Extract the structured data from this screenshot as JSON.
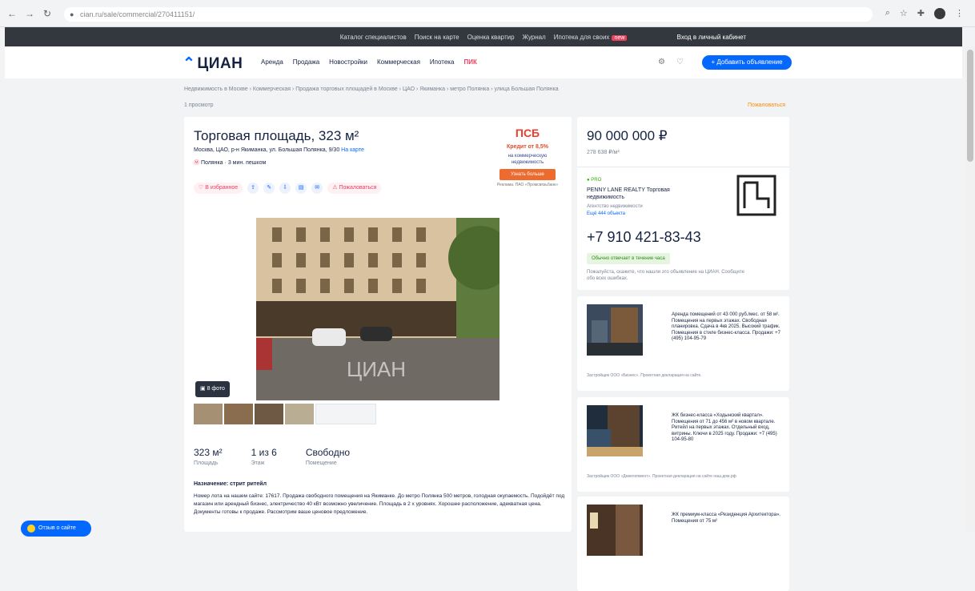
{
  "browser": {
    "url": "cian.ru/sale/commercial/270411151/"
  },
  "topstrip": {
    "items": [
      "Каталог специалистов",
      "Поиск на карте",
      "Оценка квартир",
      "Журнал",
      "Ипотека для своих"
    ],
    "badge": "new",
    "login": "Вход в личный кабинет"
  },
  "header": {
    "logo": "ЦИАН",
    "menu": [
      "Аренда",
      "Продажа",
      "Новостройки",
      "Коммерческая",
      "Ипотека"
    ],
    "menu_special": "ПИК",
    "add_button": "+ Добавить объявление"
  },
  "breadcrumb": "Недвижимость в Москве › Коммерческая › Продажа торговых площадей в Москве › ЦАО › Якиманка › метро Полянка › улица Большая Полянка",
  "views": "1 просмотр",
  "report": "Пожаловаться",
  "listing": {
    "title": "Торговая площадь, 323 м²",
    "address": "Москва, ЦАО, р-н Якиманка, ул. Большая Полянка, 9/30",
    "address_link": "На карте",
    "metro": "Полянка",
    "metro_time": "3 мин. пешком",
    "actions": {
      "favorite": "В избранное",
      "complain": "Пожаловаться"
    },
    "photo_count": "8 фото",
    "facts": [
      {
        "value": "323 м²",
        "label": "Площадь"
      },
      {
        "value": "1 из 6",
        "label": "Этаж"
      },
      {
        "value": "Свободно",
        "label": "Помещение"
      }
    ],
    "desc_title": "Назначение: стрит ритейл",
    "description": "Номер лота на нашем сайте: 17617. Продажа свободного помещения на Якиманке. До метро Полянка 500 метров, голодная окупаемость. Подойдёт под магазин или арендный бизнес, электричество 40 кВт возможно увеличение. Площадь в 2 х уровнях. Хорошее расположение, адекватная цена. Документы готовы к продаже. Рассмотрим ваше ценовое предложение."
  },
  "ad_psb": {
    "logo": "ПСБ",
    "credit": "Кредит от 8,5%",
    "sub": "на коммерческую недвижимость",
    "button": "Узнать больше",
    "fine": "Реклама. ПАО «Промсвязьбанк»"
  },
  "price_card": {
    "price": "90 000 000 ₽",
    "price_per_m": "278 638 ₽/м²",
    "agent_status": "PRO",
    "agent_name": "PENNY LANE REALTY Торговая недвижимость",
    "agent_type": "Агентство недвижимости",
    "agent_more": "Ещё 444 объекта",
    "phone": "+7 910 421-83-43",
    "reply": "Обычно отвечает в течение часа",
    "note": "Пожалуйста, скажите, что нашли это объявление на ЦИАН. Сообщите обо всех ошибках."
  },
  "promos": [
    {
      "text": "Аренда помещений от 43 000 руб./мес. от 58 м². Помещения на первых этажах. Свободная планировка. Сдача в 4кв 2025. Высокий трафик. Помещения в стиле бизнес-класса. Продажи: +7 (495) 104-95-79",
      "foot": "Застройщик ООО «Бизнес». Проектная декларация на сайте."
    },
    {
      "text": "ЖК бизнес-класса «Ходынский квартал». Помещения от 71 до 456 м² в новом квартале. Ритейл на первых этажах. Отдельный вход, витрины. Ключи в 2025 году. Продажи: +7 (495) 104-95-80",
      "foot": "Застройщик ООО «Девелопмент». Проектная декларация на сайте наш.дом.рф"
    },
    {
      "text": "ЖК премиум-класса «Резиденция Архитектора». Помещения от 75 м²",
      "foot": ""
    }
  ],
  "chat_button": "Отзыв о сайте",
  "colors": {
    "brand": "#0468ff",
    "accent_red": "#e84260",
    "text": "#152242"
  }
}
